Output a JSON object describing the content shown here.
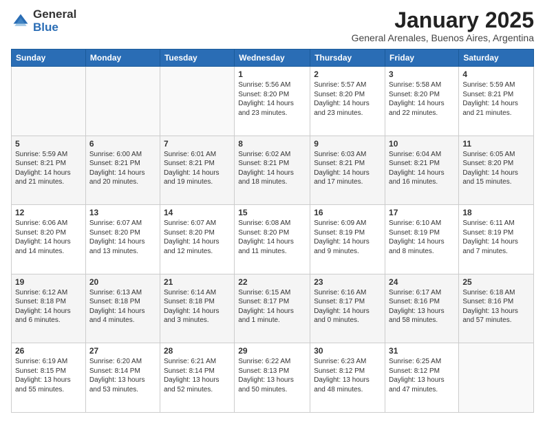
{
  "logo": {
    "general": "General",
    "blue": "Blue"
  },
  "title": "January 2025",
  "location": "General Arenales, Buenos Aires, Argentina",
  "days_of_week": [
    "Sunday",
    "Monday",
    "Tuesday",
    "Wednesday",
    "Thursday",
    "Friday",
    "Saturday"
  ],
  "weeks": [
    [
      {
        "day": "",
        "info": ""
      },
      {
        "day": "",
        "info": ""
      },
      {
        "day": "",
        "info": ""
      },
      {
        "day": "1",
        "info": "Sunrise: 5:56 AM\nSunset: 8:20 PM\nDaylight: 14 hours\nand 23 minutes."
      },
      {
        "day": "2",
        "info": "Sunrise: 5:57 AM\nSunset: 8:20 PM\nDaylight: 14 hours\nand 23 minutes."
      },
      {
        "day": "3",
        "info": "Sunrise: 5:58 AM\nSunset: 8:20 PM\nDaylight: 14 hours\nand 22 minutes."
      },
      {
        "day": "4",
        "info": "Sunrise: 5:59 AM\nSunset: 8:21 PM\nDaylight: 14 hours\nand 21 minutes."
      }
    ],
    [
      {
        "day": "5",
        "info": "Sunrise: 5:59 AM\nSunset: 8:21 PM\nDaylight: 14 hours\nand 21 minutes."
      },
      {
        "day": "6",
        "info": "Sunrise: 6:00 AM\nSunset: 8:21 PM\nDaylight: 14 hours\nand 20 minutes."
      },
      {
        "day": "7",
        "info": "Sunrise: 6:01 AM\nSunset: 8:21 PM\nDaylight: 14 hours\nand 19 minutes."
      },
      {
        "day": "8",
        "info": "Sunrise: 6:02 AM\nSunset: 8:21 PM\nDaylight: 14 hours\nand 18 minutes."
      },
      {
        "day": "9",
        "info": "Sunrise: 6:03 AM\nSunset: 8:21 PM\nDaylight: 14 hours\nand 17 minutes."
      },
      {
        "day": "10",
        "info": "Sunrise: 6:04 AM\nSunset: 8:21 PM\nDaylight: 14 hours\nand 16 minutes."
      },
      {
        "day": "11",
        "info": "Sunrise: 6:05 AM\nSunset: 8:20 PM\nDaylight: 14 hours\nand 15 minutes."
      }
    ],
    [
      {
        "day": "12",
        "info": "Sunrise: 6:06 AM\nSunset: 8:20 PM\nDaylight: 14 hours\nand 14 minutes."
      },
      {
        "day": "13",
        "info": "Sunrise: 6:07 AM\nSunset: 8:20 PM\nDaylight: 14 hours\nand 13 minutes."
      },
      {
        "day": "14",
        "info": "Sunrise: 6:07 AM\nSunset: 8:20 PM\nDaylight: 14 hours\nand 12 minutes."
      },
      {
        "day": "15",
        "info": "Sunrise: 6:08 AM\nSunset: 8:20 PM\nDaylight: 14 hours\nand 11 minutes."
      },
      {
        "day": "16",
        "info": "Sunrise: 6:09 AM\nSunset: 8:19 PM\nDaylight: 14 hours\nand 9 minutes."
      },
      {
        "day": "17",
        "info": "Sunrise: 6:10 AM\nSunset: 8:19 PM\nDaylight: 14 hours\nand 8 minutes."
      },
      {
        "day": "18",
        "info": "Sunrise: 6:11 AM\nSunset: 8:19 PM\nDaylight: 14 hours\nand 7 minutes."
      }
    ],
    [
      {
        "day": "19",
        "info": "Sunrise: 6:12 AM\nSunset: 8:18 PM\nDaylight: 14 hours\nand 6 minutes."
      },
      {
        "day": "20",
        "info": "Sunrise: 6:13 AM\nSunset: 8:18 PM\nDaylight: 14 hours\nand 4 minutes."
      },
      {
        "day": "21",
        "info": "Sunrise: 6:14 AM\nSunset: 8:18 PM\nDaylight: 14 hours\nand 3 minutes."
      },
      {
        "day": "22",
        "info": "Sunrise: 6:15 AM\nSunset: 8:17 PM\nDaylight: 14 hours\nand 1 minute."
      },
      {
        "day": "23",
        "info": "Sunrise: 6:16 AM\nSunset: 8:17 PM\nDaylight: 14 hours\nand 0 minutes."
      },
      {
        "day": "24",
        "info": "Sunrise: 6:17 AM\nSunset: 8:16 PM\nDaylight: 13 hours\nand 58 minutes."
      },
      {
        "day": "25",
        "info": "Sunrise: 6:18 AM\nSunset: 8:16 PM\nDaylight: 13 hours\nand 57 minutes."
      }
    ],
    [
      {
        "day": "26",
        "info": "Sunrise: 6:19 AM\nSunset: 8:15 PM\nDaylight: 13 hours\nand 55 minutes."
      },
      {
        "day": "27",
        "info": "Sunrise: 6:20 AM\nSunset: 8:14 PM\nDaylight: 13 hours\nand 53 minutes."
      },
      {
        "day": "28",
        "info": "Sunrise: 6:21 AM\nSunset: 8:14 PM\nDaylight: 13 hours\nand 52 minutes."
      },
      {
        "day": "29",
        "info": "Sunrise: 6:22 AM\nSunset: 8:13 PM\nDaylight: 13 hours\nand 50 minutes."
      },
      {
        "day": "30",
        "info": "Sunrise: 6:23 AM\nSunset: 8:12 PM\nDaylight: 13 hours\nand 48 minutes."
      },
      {
        "day": "31",
        "info": "Sunrise: 6:25 AM\nSunset: 8:12 PM\nDaylight: 13 hours\nand 47 minutes."
      },
      {
        "day": "",
        "info": ""
      }
    ]
  ]
}
